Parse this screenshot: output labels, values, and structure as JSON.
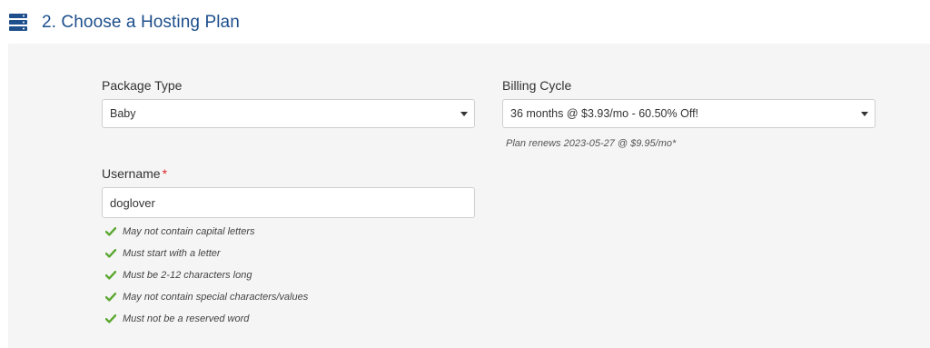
{
  "header": {
    "title": "2. Choose a Hosting Plan",
    "icon": "server-icon",
    "color": "#1d4f8c"
  },
  "package_type": {
    "label": "Package Type",
    "selected": "Baby"
  },
  "billing_cycle": {
    "label": "Billing Cycle",
    "selected": "36 months @ $3.93/mo - 60.50% Off!",
    "renew_note": "Plan renews 2023-05-27 @ $9.95/mo*"
  },
  "username": {
    "label": "Username",
    "required_mark": "*",
    "value": "doglover",
    "rules": [
      "May not contain capital letters",
      "Must start with a letter",
      "Must be 2-12 characters long",
      "May not contain special characters/values",
      "Must not be a reserved word"
    ],
    "rule_icon": "check-icon",
    "check_color": "#5aa72f"
  }
}
